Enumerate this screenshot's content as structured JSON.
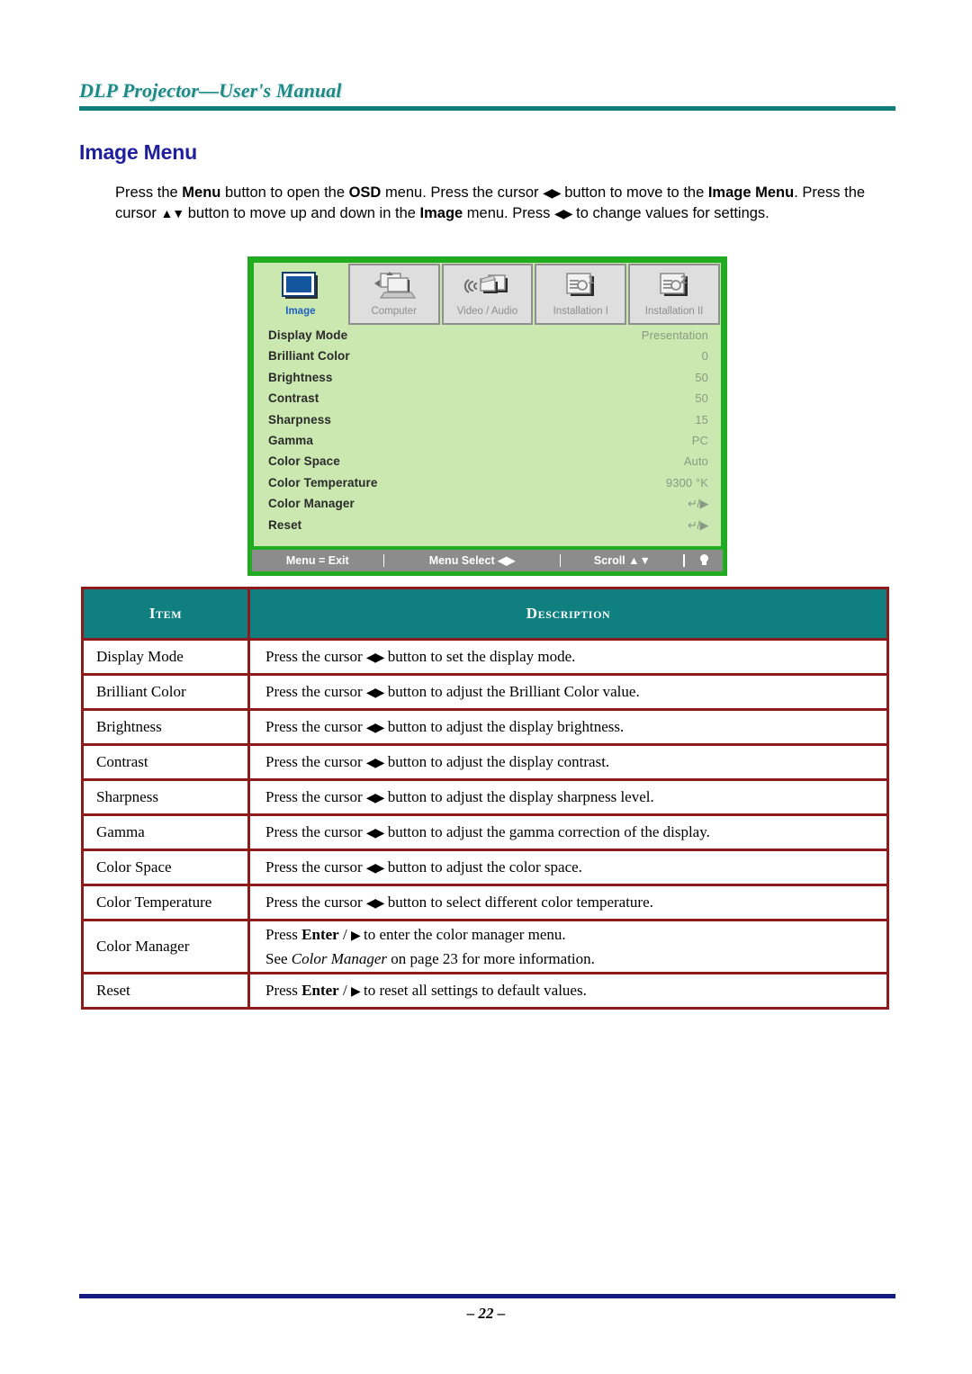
{
  "header": {
    "title": "DLP Projector—User's Manual",
    "rule_color": "#0e7f7b"
  },
  "section": {
    "heading": "Image Menu",
    "heading_color": "#1f1f9e"
  },
  "intro": {
    "p1": "Press the ",
    "b1": "Menu",
    "p2": " button to open the ",
    "b2": "OSD",
    "p3": " menu. Press the cursor ",
    "a1": "◀▶",
    "p4": " button to move to the ",
    "b3": "Image Menu",
    "p5": ". Press the cursor ",
    "a2": "▲▼",
    "p6": " button to move up and down in the ",
    "b4": "Image",
    "p7": " menu. Press ",
    "a3": "◀▶",
    "p8": " to change values for settings."
  },
  "osd": {
    "border_color": "#1faa1f",
    "background_color": "#cbe8b0",
    "tabs": [
      {
        "label": "Image",
        "icon": "image-screen-icon",
        "active": true
      },
      {
        "label": "Computer",
        "icon": "computer-laptop-icon",
        "active": false
      },
      {
        "label": "Video / Audio",
        "icon": "video-audio-icon",
        "active": false
      },
      {
        "label": "Installation I",
        "icon": "projector-1-icon",
        "active": false
      },
      {
        "label": "Installation II",
        "icon": "projector-2-icon",
        "active": false
      }
    ],
    "rows": [
      {
        "label": "Display Mode",
        "value": "Presentation"
      },
      {
        "label": "Brilliant Color",
        "value": "0"
      },
      {
        "label": "Brightness",
        "value": "50"
      },
      {
        "label": "Contrast",
        "value": "50"
      },
      {
        "label": "Sharpness",
        "value": "15"
      },
      {
        "label": "Gamma",
        "value": "PC"
      },
      {
        "label": "Color Space",
        "value": "Auto"
      },
      {
        "label": "Color Temperature",
        "value": "9300 °K"
      },
      {
        "label": "Color Manager",
        "value": "↵/▶"
      },
      {
        "label": "Reset",
        "value": "↵/▶"
      }
    ],
    "status": {
      "exit": "Menu = Exit",
      "select": "Menu Select ◀▶",
      "scroll": "Scroll ▲▼",
      "lamp_icon": "lamp-bulb-icon"
    }
  },
  "table": {
    "headers": {
      "item": "Item",
      "description": "Description"
    },
    "header_bg": "#0f7f80",
    "border_color": "#8e1b1b",
    "rows": [
      {
        "item": "Display Mode",
        "desc_pre": "Press the cursor ",
        "desc_arrow": "◀▶",
        "desc_post": " button to set the display mode."
      },
      {
        "item": "Brilliant Color",
        "desc_pre": "Press the cursor ",
        "desc_arrow": "◀▶",
        "desc_post": " button to adjust the Brilliant Color value."
      },
      {
        "item": "Brightness",
        "desc_pre": "Press the cursor ",
        "desc_arrow": "◀▶",
        "desc_post": " button to adjust the display brightness."
      },
      {
        "item": "Contrast",
        "desc_pre": "Press the cursor ",
        "desc_arrow": "◀▶",
        "desc_post": " button to adjust the display contrast."
      },
      {
        "item": "Sharpness",
        "desc_pre": "Press the cursor ",
        "desc_arrow": "◀▶",
        "desc_post": " button to adjust the display sharpness level."
      },
      {
        "item": "Gamma",
        "desc_pre": "Press the cursor ",
        "desc_arrow": "◀▶",
        "desc_post": " button to adjust the gamma correction of the display."
      },
      {
        "item": "Color Space",
        "desc_pre": "Press the cursor ",
        "desc_arrow": "◀▶",
        "desc_post": " button to adjust the color space."
      },
      {
        "item": "Color Temperature",
        "desc_pre": "Press the cursor ",
        "desc_arrow": "◀▶",
        "desc_post": " button to select different color temperature."
      }
    ],
    "color_manager_row": {
      "item": "Color Manager",
      "l1_pre": "Press ",
      "l1_bold": "Enter",
      "l1_mid": " / ",
      "l1_arrow": "▶",
      "l1_post": " to enter the color manager menu.",
      "l2_pre": "See ",
      "l2_italic": "Color Manager",
      "l2_post": " on page 23 for more information."
    },
    "reset_row": {
      "item": "Reset",
      "pre": "Press ",
      "bold": "Enter",
      "mid": " / ",
      "arrow": "▶",
      "post": " to reset all settings to default values."
    }
  },
  "footer": {
    "page_number": "– 22 –",
    "rule_color": "#161b82"
  }
}
